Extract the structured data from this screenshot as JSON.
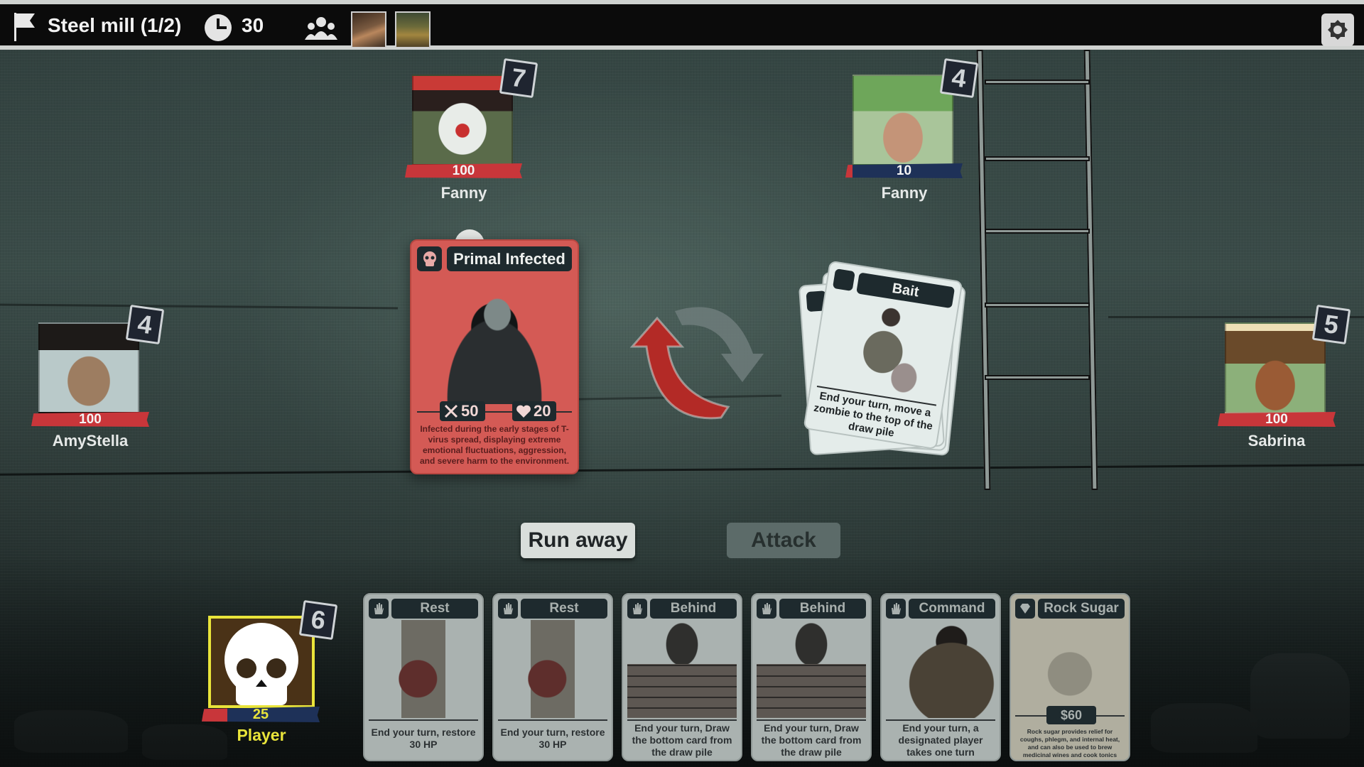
{
  "topbar": {
    "location": "Steel mill (1/2)",
    "turns_remaining": "30",
    "icons": [
      "flag-icon",
      "clock-icon",
      "group-icon",
      "settings-icon"
    ],
    "party_avatars": [
      "party-avatar-1",
      "party-avatar-2"
    ]
  },
  "opponents": [
    {
      "name": "Fanny",
      "hp": "100",
      "card_count": "7",
      "hp_bar_color": "#c8363a",
      "hp_fraction": 1.0
    },
    {
      "name": "Fanny",
      "hp": "10",
      "card_count": "4",
      "hp_bar_color": "#1e3158",
      "hp_fraction": 0.1
    },
    {
      "name": "AmyStella",
      "hp": "100",
      "card_count": "4",
      "hp_bar_color": "#c8363a",
      "hp_fraction": 1.0
    },
    {
      "name": "Sabrina",
      "hp": "100",
      "card_count": "5",
      "hp_bar_color": "#c8363a",
      "hp_fraction": 1.0
    }
  ],
  "encounter": {
    "name": "Primal Infected",
    "attack": "50",
    "health": "20",
    "description": "Infected during the early stages of T-virus spread, displaying extreme emotional fluctuations, aggression, and severe harm to the environment.",
    "card_color": "#d45a55"
  },
  "draw_pile": {
    "top_card": {
      "title": "Bait",
      "text": "End your turn, move a zombie to the top of the draw pile"
    }
  },
  "actions": {
    "run_away": "Run away",
    "attack": "Attack"
  },
  "player": {
    "name": "Player",
    "hp": "25",
    "hp_fraction": 0.25,
    "card_count": "6",
    "highlight_color": "#e9e43a"
  },
  "hand": [
    {
      "title": "Rest",
      "type": "action",
      "text": "End your turn, restore 30 HP"
    },
    {
      "title": "Rest",
      "type": "action",
      "text": "End your turn, restore 30 HP"
    },
    {
      "title": "Behind",
      "type": "action",
      "text": "End your turn, Draw the bottom card from the draw pile"
    },
    {
      "title": "Behind",
      "type": "action",
      "text": "End your turn, Draw the bottom card from the draw pile"
    },
    {
      "title": "Command",
      "type": "action",
      "text": "End your turn, a designated player takes one turn"
    },
    {
      "title": "Rock Sugar",
      "type": "item",
      "price": "$60",
      "text": "Rock sugar provides relief for coughs, phlegm, and internal heat, and can also be used to brew medicinal wines and cook tonics"
    }
  ]
}
